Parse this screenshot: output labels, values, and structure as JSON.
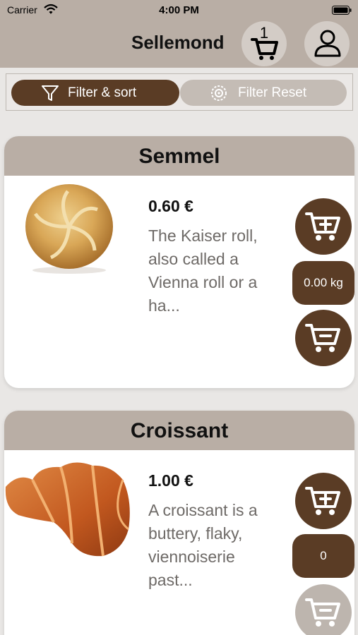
{
  "status_bar": {
    "carrier": "Carrier",
    "time": "4:00 PM"
  },
  "header": {
    "title": "Sellemond",
    "cart_count": "1"
  },
  "filters": {
    "filter_sort_label": "Filter & sort",
    "reset_label": "Filter Reset"
  },
  "colors": {
    "accent": "#5a3c25",
    "header_bg": "#b9aea5",
    "page_bg": "#e9e7e5",
    "disabled": "#bdb5ae"
  },
  "products": [
    {
      "name": "Semmel",
      "price": "0.60 €",
      "description_lines": [
        "The Kaiser roll,",
        "also called a",
        "Vienna roll or a",
        "ha..."
      ],
      "quantity": "0.00 kg",
      "image": "kaiser-roll-image"
    },
    {
      "name": "Croissant",
      "price": "1.00 €",
      "description_lines": [
        "A croissant is a",
        "buttery, flaky,",
        "viennoiserie",
        "past..."
      ],
      "quantity": "0",
      "image": "croissant-image"
    }
  ],
  "icons": {
    "wifi": "wifi-icon",
    "battery": "battery-icon",
    "cart": "cart-icon",
    "profile": "user-icon",
    "filter": "funnel-icon",
    "reset": "reset-icon",
    "add": "cart-add-icon",
    "remove": "cart-remove-icon"
  }
}
